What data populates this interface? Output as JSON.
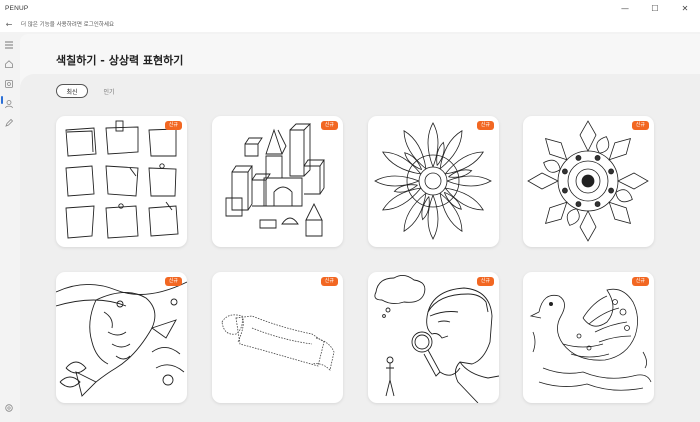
{
  "window": {
    "app_title": "PENUP",
    "minimize": "—",
    "maximize": "☐",
    "close": "✕"
  },
  "login_bar": {
    "back": "←",
    "message": "더 많은 기능을 사용하려면 로그인하세요"
  },
  "sidebar": {
    "items": [
      {
        "icon": "menu-icon"
      },
      {
        "icon": "home-icon"
      },
      {
        "icon": "coloring-icon"
      },
      {
        "icon": "profile-icon"
      },
      {
        "icon": "pen-icon"
      },
      {
        "icon": "settings-icon"
      }
    ]
  },
  "page": {
    "title": "색칠하기 - 상상력 표현하기"
  },
  "tabs": [
    {
      "label": "최신",
      "active": true
    },
    {
      "label": "인기",
      "active": false
    }
  ],
  "cards": [
    {
      "name": "sticky-notes-drawing",
      "badge": "신규"
    },
    {
      "name": "toy-blocks-castle-drawing",
      "badge": "신규"
    },
    {
      "name": "flower-mandala-drawing",
      "badge": "신규"
    },
    {
      "name": "ornate-mandala-drawing",
      "badge": "신규"
    },
    {
      "name": "koi-fish-drawing",
      "badge": "신규"
    },
    {
      "name": "ribbon-banner-drawing",
      "badge": "신규"
    },
    {
      "name": "man-with-magnifier-drawing",
      "badge": "신규"
    },
    {
      "name": "swan-pattern-drawing",
      "badge": "신규"
    }
  ]
}
